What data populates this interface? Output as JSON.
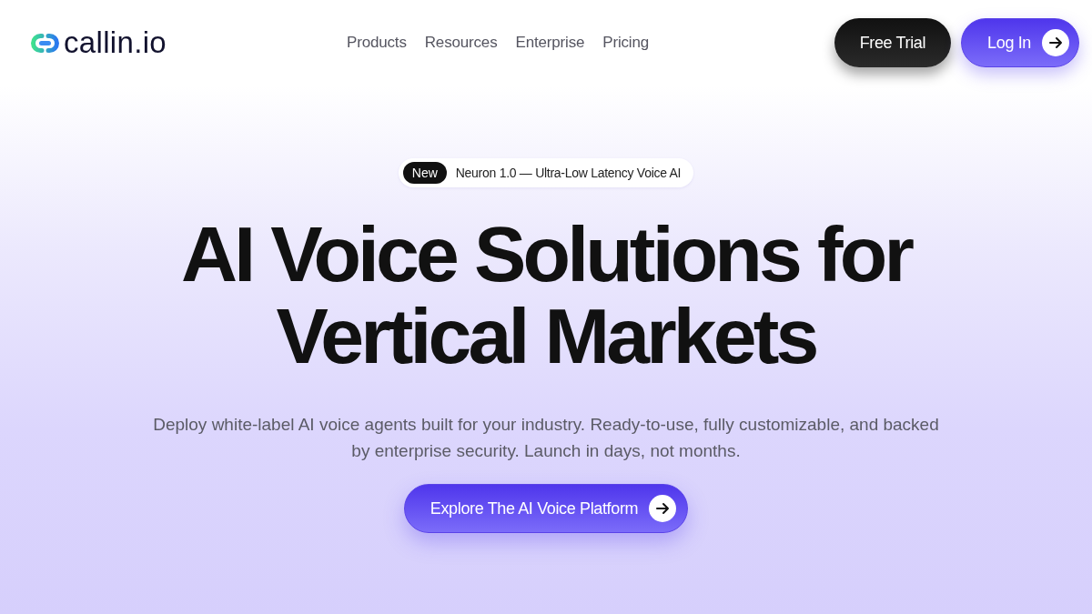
{
  "logo": {
    "text": "callin.io"
  },
  "nav": {
    "links": [
      "Products",
      "Resources",
      "Enterprise",
      "Pricing"
    ]
  },
  "actions": [
    {
      "label": "Free Trial",
      "kind": "dark"
    },
    {
      "label": "Log In",
      "kind": "primary"
    }
  ],
  "hero": {
    "badge": {
      "tag": "New",
      "text": "Neuron 1.0 — Ultra-Low Latency Voice AI"
    },
    "headline": "AI Voice Solutions for Vertical Markets",
    "subtitle": "Deploy white-label AI voice agents built for your industry. Ready-to-use, fully customizable, and backed by enterprise security. Launch in days, not months.",
    "cta": {
      "label": "Explore The AI Voice Platform"
    }
  }
}
